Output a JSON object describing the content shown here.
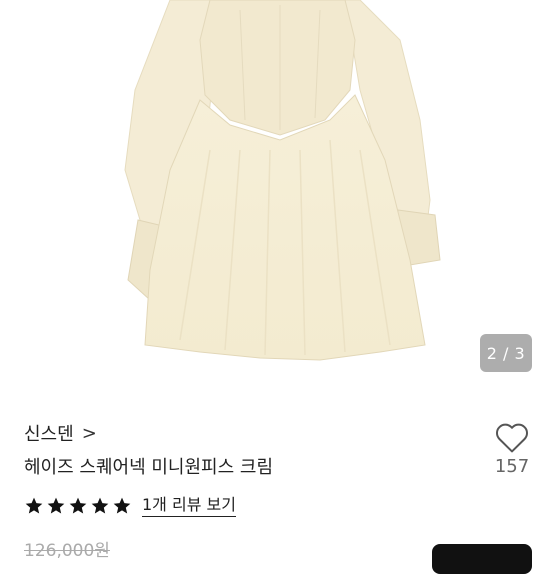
{
  "gallery": {
    "current_page": "2",
    "total_pages": "3",
    "indicator_text": "2 / 3"
  },
  "product": {
    "brand": "신스덴",
    "brand_chevron": ">",
    "title": "헤이즈 스퀘어넥 미니원피스 크림",
    "like_count": "157",
    "rating_stars": 5,
    "review_link": "1개 리뷰 보기",
    "original_price": "126,000원"
  },
  "icons": {
    "like": "heart-outline-icon",
    "star": "star-filled-icon"
  },
  "colors": {
    "dress": "#f5eed8",
    "cta": "#111111",
    "text": "#222222",
    "muted": "#aaaaaa"
  }
}
